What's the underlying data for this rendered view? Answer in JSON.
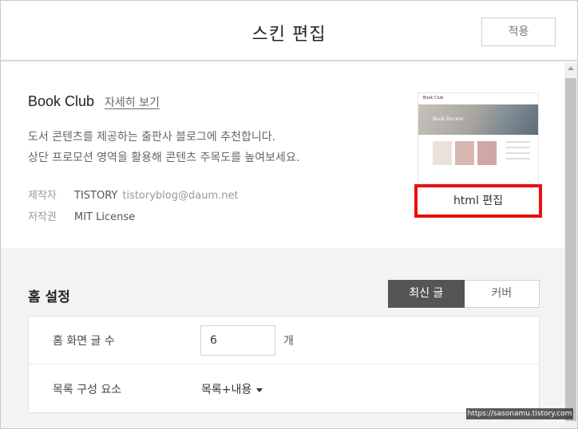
{
  "header": {
    "title": "스킨 편집",
    "apply_label": "적용"
  },
  "skin": {
    "name": "Book Club",
    "detail_link": "자세히 보기",
    "description_line1": "도서 콘텐츠를 제공하는 출판사 블로그에 추천합니다.",
    "description_line2": "상단 프로모션 영역을 활용해 콘텐츠 주목도를 높여보세요.",
    "maker_label": "제작자",
    "maker_value": "TISTORY",
    "maker_email": "tistoryblog@daum.net",
    "copyright_label": "저작권",
    "copyright_value": "MIT License",
    "html_edit_label": "html 편집",
    "thumbnail": {
      "logo_text": "Book Club",
      "hero_text": "Book Review"
    }
  },
  "home_settings": {
    "title": "홈 설정",
    "tabs": [
      {
        "label": "최신 글",
        "active": true
      },
      {
        "label": "커버",
        "active": false
      }
    ],
    "post_count_label": "홈 화면 글 수",
    "post_count_value": "6",
    "post_count_unit": "개",
    "list_elements_label": "목록 구성 요소",
    "list_elements_value": "목록+내용"
  },
  "watermark": "https://sasonamu.tistory.com",
  "colors": {
    "highlight_border": "#e81010",
    "active_tab_bg": "#555555",
    "gray_area_bg": "#f3f3f3"
  }
}
